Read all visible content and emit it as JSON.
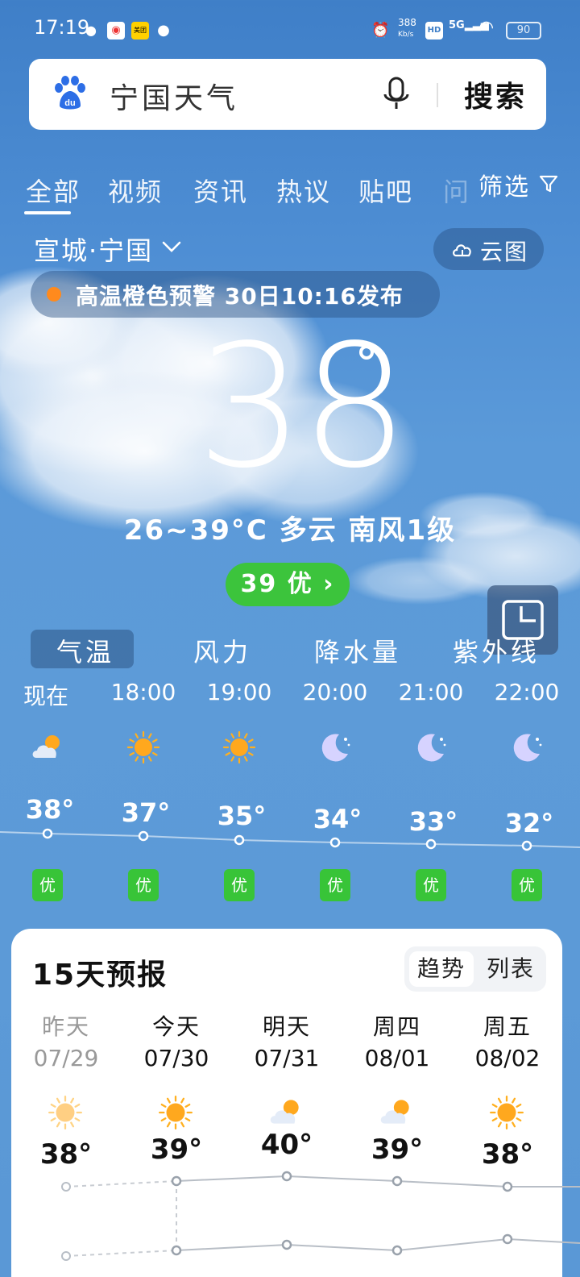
{
  "status_bar": {
    "time": "17:19",
    "net_speed": "388",
    "net_unit": "Kb/s",
    "hd": "HD",
    "signal": "5G",
    "battery": "90"
  },
  "search": {
    "query": "宁国天气",
    "button": "搜索"
  },
  "tabs": {
    "items": [
      "全部",
      "视频",
      "资讯",
      "热议",
      "贴吧",
      "问"
    ],
    "filter": "筛选"
  },
  "location": {
    "name": "宣城·宁国",
    "cloud_map": "云图"
  },
  "alert": {
    "text": "高温橙色预警 30日10:16发布"
  },
  "current": {
    "temp": "38",
    "summary": "26~39°C 多云 南风1级",
    "aqi": "39 优 ›"
  },
  "metric_tabs": {
    "items": [
      "气温",
      "风力",
      "降水量",
      "紫外线"
    ]
  },
  "hourly": [
    {
      "time": "现在",
      "temp": "38°",
      "icon": "partly-cloudy-icon",
      "aqi": "优"
    },
    {
      "time": "18:00",
      "temp": "37°",
      "icon": "sun-icon",
      "aqi": "优"
    },
    {
      "time": "19:00",
      "temp": "35°",
      "icon": "sun-icon",
      "aqi": "优"
    },
    {
      "time": "20:00",
      "temp": "34°",
      "icon": "moon-icon",
      "aqi": "优"
    },
    {
      "time": "21:00",
      "temp": "33°",
      "icon": "moon-icon",
      "aqi": "优"
    },
    {
      "time": "22:00",
      "temp": "32°",
      "icon": "moon-icon",
      "aqi": "优"
    }
  ],
  "forecast": {
    "title": "15天预报",
    "toggle": {
      "trend": "趋势",
      "list": "列表"
    },
    "days": [
      {
        "name": "昨天",
        "date": "07/29",
        "high": "38°",
        "icon": "sun-icon"
      },
      {
        "name": "今天",
        "date": "07/30",
        "high": "39°",
        "icon": "sun-icon"
      },
      {
        "name": "明天",
        "date": "07/31",
        "high": "40°",
        "icon": "partly-cloudy-icon"
      },
      {
        "name": "周四",
        "date": "08/01",
        "high": "39°",
        "icon": "partly-cloudy-icon"
      },
      {
        "name": "周五",
        "date": "08/02",
        "high": "38°",
        "icon": "sun-icon"
      }
    ]
  },
  "colors": {
    "aqi_good": "#3cc43c",
    "alert_orange": "#ff8a1d",
    "sun": "#ffb020"
  }
}
